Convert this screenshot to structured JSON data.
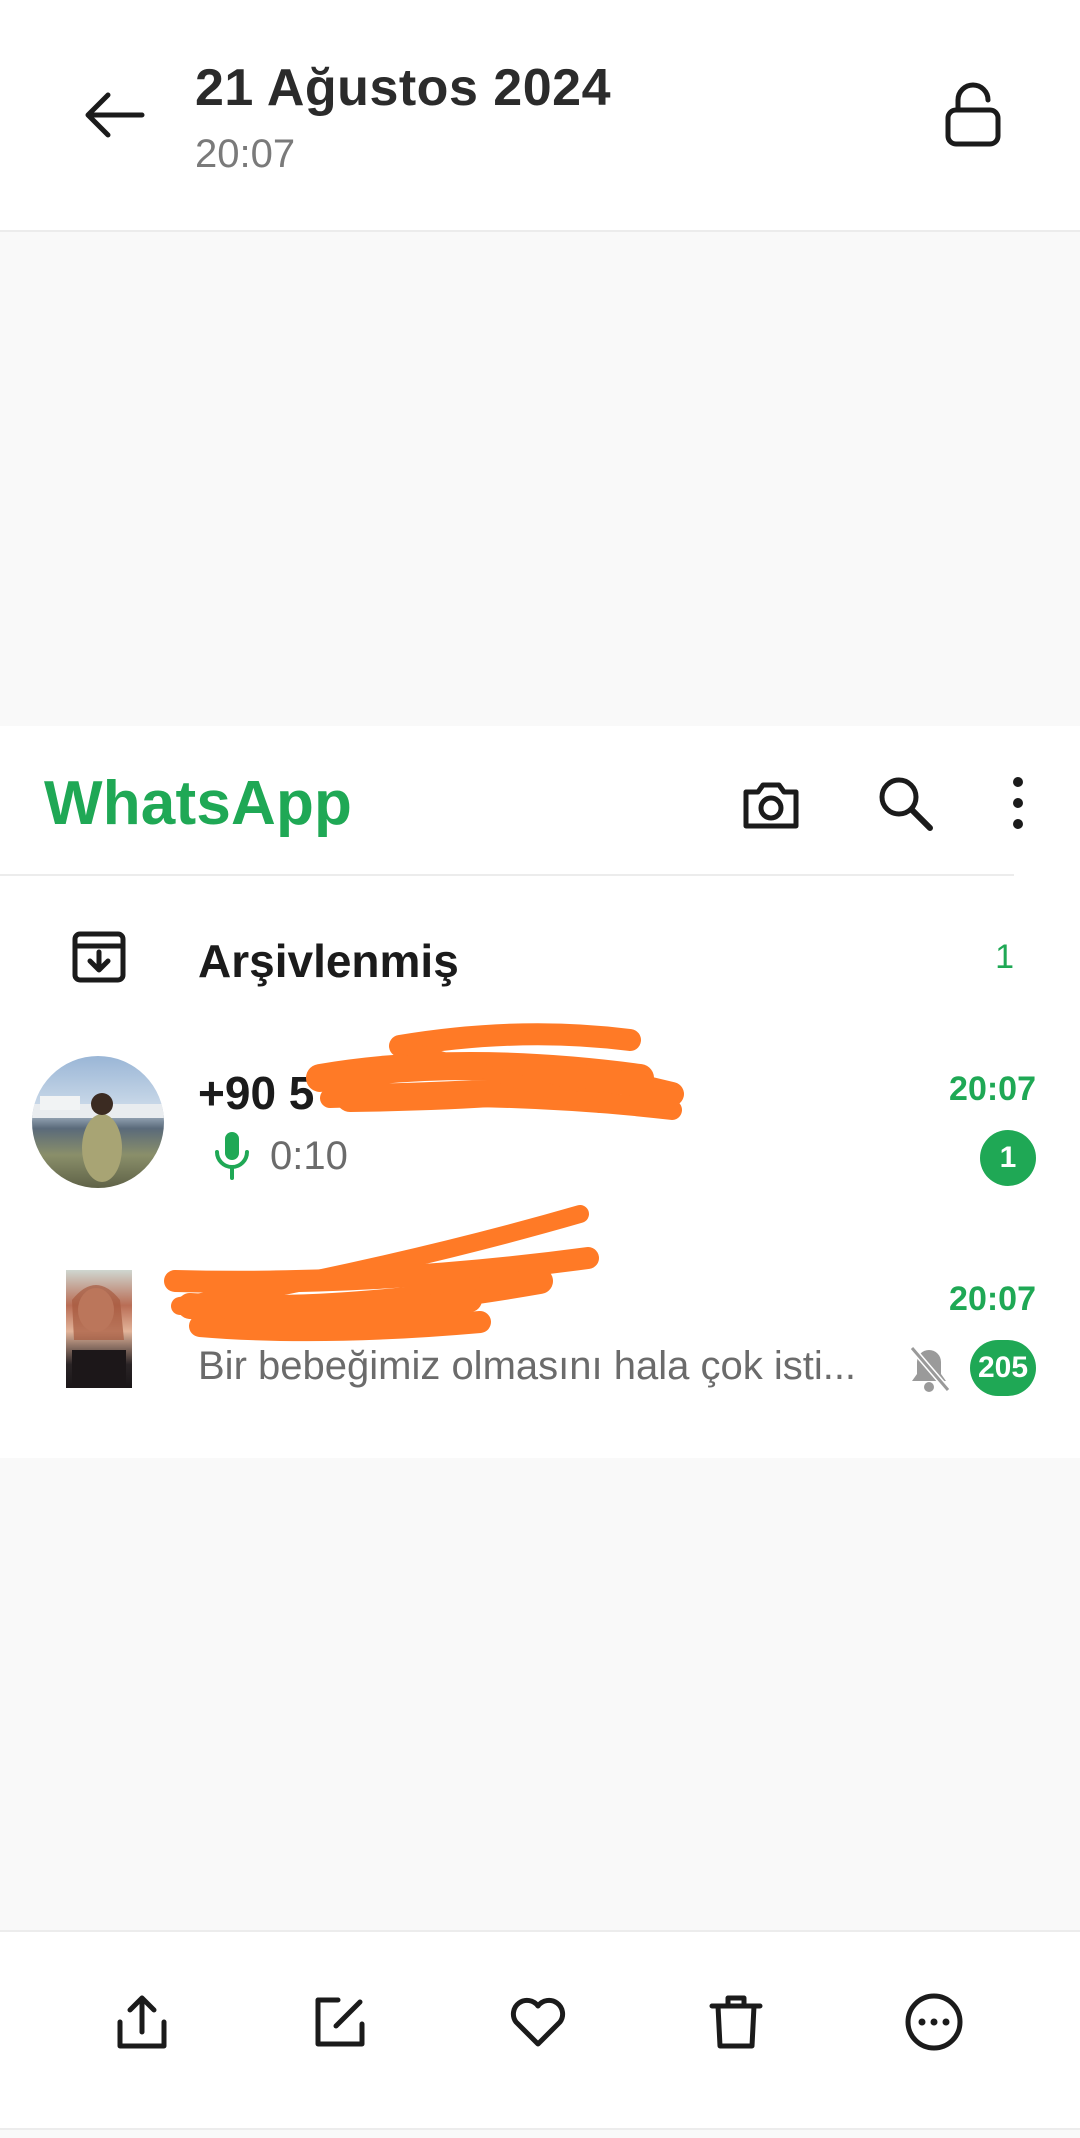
{
  "viewer": {
    "date": "21 Ağustos 2024",
    "time": "20:07"
  },
  "whatsapp": {
    "app_title": "WhatsApp",
    "archived": {
      "label": "Arşivlenmiş",
      "count": "1"
    },
    "chats": [
      {
        "name": "+90 5",
        "time": "20:07",
        "voice_duration": "0:10",
        "unread": "1"
      },
      {
        "name": "",
        "time": "20:07",
        "preview": "Bir bebeğimiz olmasını hala çok isti...",
        "unread": "205",
        "muted": true
      }
    ],
    "accent_color": "#1fa855",
    "redaction_color": "#ff7a26"
  },
  "actions": {
    "share": "share-icon",
    "edit": "edit-icon",
    "favorite": "heart-icon",
    "delete": "trash-icon",
    "more": "more-icon"
  }
}
